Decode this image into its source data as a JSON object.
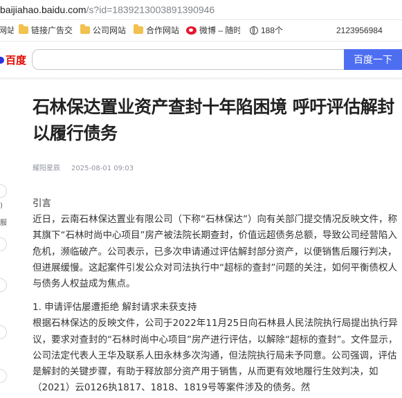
{
  "browser": {
    "url_host": "baijiahao.baidu.com",
    "url_path": "/s?id=1839213003891390946",
    "bookmarks": [
      {
        "label": "网站",
        "icon": "none"
      },
      {
        "label": "链接广告交",
        "icon": "folder-icon"
      },
      {
        "label": "公司网站",
        "icon": "folder-icon"
      },
      {
        "label": "合作网站",
        "icon": "folder-icon"
      },
      {
        "label": "微博 – 随时",
        "icon": "weibo-icon"
      },
      {
        "label": "188个",
        "icon": "globe-icon"
      },
      {
        "label": "2123956984",
        "icon": "none"
      }
    ]
  },
  "search": {
    "logo_text": "百度",
    "button_label": "百度一下",
    "input_value": ""
  },
  "article": {
    "title": "石林保达置业资产查封十年陷困境 呼吁评估解封以履行债务",
    "author": "耀阳星辰",
    "date": "2025-08-01 09:03",
    "paragraphs": [
      "引言",
      "近日，云南石林保达置业有限公司（下称“石林保达”）向有关部门提交情况反映文件，称其旗下“石林时尚中心项目”房产被法院长期查封，价值远超债务总额，导致公司经营陷入危机，濒临破产。公司表示，已多次申请通过评估解封部分资产，以便销售后履行判决，但进展缓慢。这起案件引发公众对司法执行中“超标的查封”问题的关注，如何平衡债权人与债务人权益成为焦点。",
      "1. 申请评估屡遭拒绝 解封请求未获支持",
      "根据石林保达的反映文件，公司于2022年11月25日向石林县人民法院执行局提出执行异议，要求对查封的“石林时尚中心项目”房产进行评估，以解除“超标的查封”。文件显示，公司法定代表人王华及联系人田永林多次沟通，但法院执行局未予同意。公司强调，评估是解封的关键步骤，有助于释放部分资产用于销售，从而更有效地履行生效判决，如（2021）云0126执1817、1818、1819号等案件涉及的债务。然"
    ]
  },
  "side_labels": [
    "",
    ")",
    "服",
    "0",
    "",
    "0",
    "",
    "",
    "",
    "0"
  ]
}
